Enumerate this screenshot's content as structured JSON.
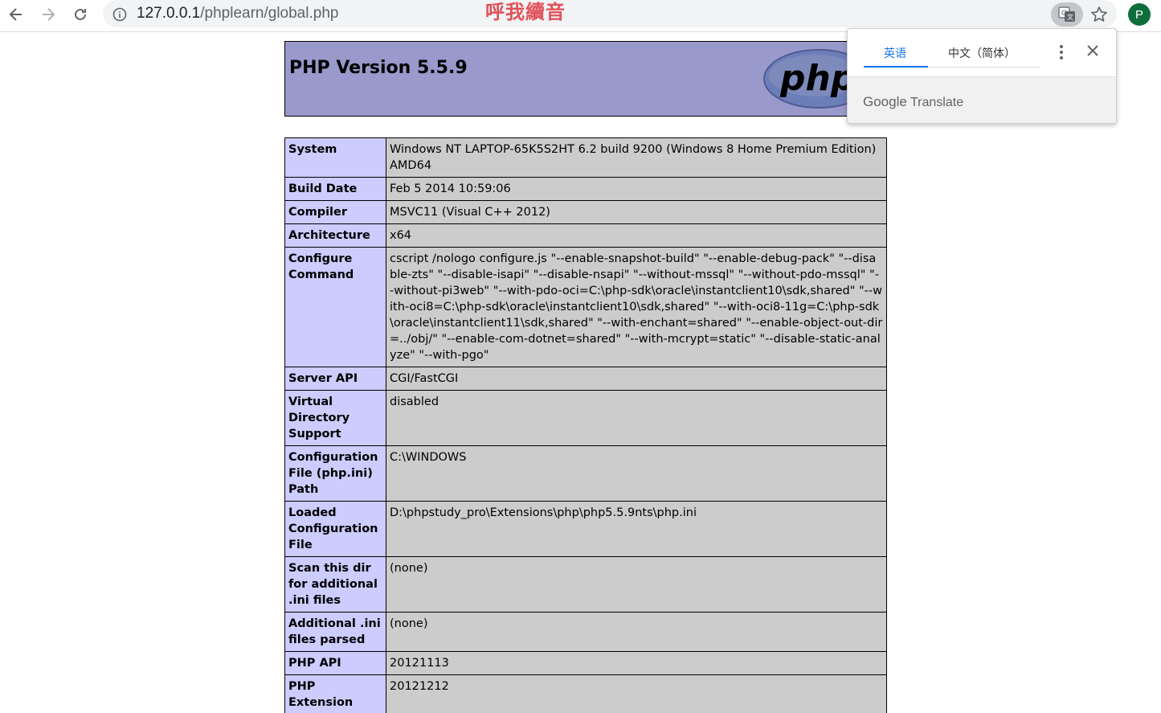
{
  "browser": {
    "url_host": "127.0.0.1",
    "url_path": "/phplearn/global.php",
    "overlay_text": "呼我續音",
    "profile_initial": "P"
  },
  "php": {
    "title": "PHP Version 5.5.9",
    "logo_text": "php",
    "rows": [
      {
        "name": "System",
        "value": "Windows NT LAPTOP-65K5S2HT 6.2 build 9200 (Windows 8 Home Premium Edition) AMD64"
      },
      {
        "name": "Build Date",
        "value": "Feb 5 2014 10:59:06"
      },
      {
        "name": "Compiler",
        "value": "MSVC11 (Visual C++ 2012)"
      },
      {
        "name": "Architecture",
        "value": "x64"
      },
      {
        "name": "Configure Command",
        "value": "cscript /nologo configure.js \"--enable-snapshot-build\" \"--enable-debug-pack\" \"--disable-zts\" \"--disable-isapi\" \"--disable-nsapi\" \"--without-mssql\" \"--without-pdo-mssql\" \"--without-pi3web\" \"--with-pdo-oci=C:\\php-sdk\\oracle\\instantclient10\\sdk,shared\" \"--with-oci8=C:\\php-sdk\\oracle\\instantclient10\\sdk,shared\" \"--with-oci8-11g=C:\\php-sdk\\oracle\\instantclient11\\sdk,shared\" \"--with-enchant=shared\" \"--enable-object-out-dir=../obj/\" \"--enable-com-dotnet=shared\" \"--with-mcrypt=static\" \"--disable-static-analyze\" \"--with-pgo\""
      },
      {
        "name": "Server API",
        "value": "CGI/FastCGI"
      },
      {
        "name": "Virtual Directory Support",
        "value": "disabled"
      },
      {
        "name": "Configuration File (php.ini) Path",
        "value": "C:\\WINDOWS"
      },
      {
        "name": "Loaded Configuration File",
        "value": "D:\\phpstudy_pro\\Extensions\\php\\php5.5.9nts\\php.ini"
      },
      {
        "name": "Scan this dir for additional .ini files",
        "value": "(none)"
      },
      {
        "name": "Additional .ini files parsed",
        "value": "(none)"
      },
      {
        "name": "PHP API",
        "value": "20121113"
      },
      {
        "name": "PHP Extension",
        "value": "20121212"
      }
    ]
  },
  "translate_popup": {
    "tab_source": "英语",
    "tab_target": "中文（简体）",
    "brand_google": "Google",
    "brand_translate": "Translate"
  },
  "colors": {
    "header_bg": "#9999cc",
    "label_bg": "#ccccff",
    "value_bg": "#cccccc",
    "accent": "#1a73e8",
    "overlay_text": "#e0525a",
    "avatar": "#0d6e3c"
  },
  "icons": [
    "back-arrow-icon",
    "forward-arrow-icon",
    "reload-icon",
    "info-icon",
    "translate-icon",
    "star-icon",
    "more-vert-icon",
    "close-icon"
  ]
}
